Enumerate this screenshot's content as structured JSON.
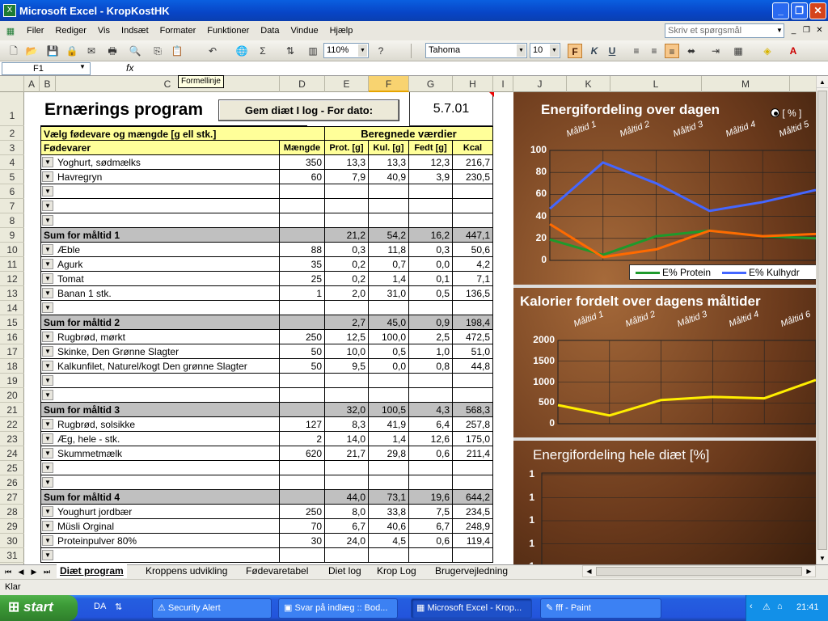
{
  "window": {
    "title": "Microsoft Excel - KropKostHK",
    "app_icon": "X",
    "controls": [
      "_",
      "❐",
      "✕"
    ]
  },
  "menu": {
    "items": [
      "Filer",
      "Rediger",
      "Vis",
      "Indsæt",
      "Formater",
      "Funktioner",
      "Data",
      "Vindue",
      "Hjælp"
    ],
    "help_placeholder": "Skriv et spørgsmål",
    "mdi": [
      "_",
      "❐",
      "✕"
    ]
  },
  "toolbar": {
    "zoom": "110%",
    "font": "Tahoma",
    "size": "10",
    "bold": "F",
    "italic": "K",
    "underline": "U"
  },
  "formula": {
    "namebox": "F1",
    "fx": "fx",
    "tooltip": "Formellinje"
  },
  "columns": [
    "A",
    "B",
    "C",
    "D",
    "E",
    "F",
    "G",
    "H",
    "I",
    "J",
    "K",
    "L",
    "M"
  ],
  "rows": [
    "1",
    "2",
    "3",
    "4",
    "5",
    "6",
    "7",
    "8",
    "9",
    "10",
    "11",
    "12",
    "13",
    "14",
    "15",
    "16",
    "17",
    "18",
    "19",
    "20",
    "21",
    "22",
    "23",
    "24",
    "25",
    "26",
    "27",
    "28",
    "29",
    "30",
    "31"
  ],
  "sheet": {
    "title": "Ernærings program",
    "save_button": "Gem diæt I log - For dato:",
    "date": "5.7.01",
    "header1_left": "Vælg fødevare og mængde [g ell stk.]",
    "header1_right": "Beregnede værdier",
    "header2": [
      "Fødevarer",
      "Mængde",
      "Prot. [g]",
      "Kul. [g]",
      "Fedt [g]",
      "Kcal"
    ],
    "data_rows": [
      {
        "food": "Yoghurt, sødmælks",
        "amt": "350",
        "p": "13,3",
        "k": "13,3",
        "f": "12,3",
        "kcal": "216,7"
      },
      {
        "food": "Havregryn",
        "amt": "60",
        "p": "7,9",
        "k": "40,9",
        "f": "3,9",
        "kcal": "230,5"
      },
      {
        "food": "",
        "amt": "",
        "p": "",
        "k": "",
        "f": "",
        "kcal": ""
      },
      {
        "food": "",
        "amt": "",
        "p": "",
        "k": "",
        "f": "",
        "kcal": ""
      },
      {
        "food": "",
        "amt": "",
        "p": "",
        "k": "",
        "f": "",
        "kcal": ""
      },
      {
        "sum": true,
        "food": "Sum for måltid 1",
        "amt": "",
        "p": "21,2",
        "k": "54,2",
        "f": "16,2",
        "kcal": "447,1"
      },
      {
        "food": "Æble",
        "amt": "88",
        "p": "0,3",
        "k": "11,8",
        "f": "0,3",
        "kcal": "50,6"
      },
      {
        "food": "Agurk",
        "amt": "35",
        "p": "0,2",
        "k": "0,7",
        "f": "0,0",
        "kcal": "4,2"
      },
      {
        "food": "Tomat",
        "amt": "25",
        "p": "0,2",
        "k": "1,4",
        "f": "0,1",
        "kcal": "7,1"
      },
      {
        "food": "Banan 1 stk.",
        "amt": "1",
        "p": "2,0",
        "k": "31,0",
        "f": "0,5",
        "kcal": "136,5"
      },
      {
        "food": "",
        "amt": "",
        "p": "",
        "k": "",
        "f": "",
        "kcal": ""
      },
      {
        "sum": true,
        "food": "Sum for måltid 2",
        "amt": "",
        "p": "2,7",
        "k": "45,0",
        "f": "0,9",
        "kcal": "198,4"
      },
      {
        "food": "Rugbrød, mørkt",
        "amt": "250",
        "p": "12,5",
        "k": "100,0",
        "f": "2,5",
        "kcal": "472,5"
      },
      {
        "food": "Skinke, Den Grønne Slagter",
        "amt": "50",
        "p": "10,0",
        "k": "0,5",
        "f": "1,0",
        "kcal": "51,0"
      },
      {
        "food": "Kalkunfilet, Naturel/kogt Den grønne Slagter",
        "amt": "50",
        "p": "9,5",
        "k": "0,0",
        "f": "0,8",
        "kcal": "44,8"
      },
      {
        "food": "",
        "amt": "",
        "p": "",
        "k": "",
        "f": "",
        "kcal": ""
      },
      {
        "food": "",
        "amt": "",
        "p": "",
        "k": "",
        "f": "",
        "kcal": ""
      },
      {
        "sum": true,
        "food": "Sum for måltid 3",
        "amt": "",
        "p": "32,0",
        "k": "100,5",
        "f": "4,3",
        "kcal": "568,3"
      },
      {
        "food": "Rugbrød, solsikke",
        "amt": "127",
        "p": "8,3",
        "k": "41,9",
        "f": "6,4",
        "kcal": "257,8"
      },
      {
        "food": "Æg, hele - stk.",
        "amt": "2",
        "p": "14,0",
        "k": "1,4",
        "f": "12,6",
        "kcal": "175,0"
      },
      {
        "food": "Skummetmælk",
        "amt": "620",
        "p": "21,7",
        "k": "29,8",
        "f": "0,6",
        "kcal": "211,4"
      },
      {
        "food": "",
        "amt": "",
        "p": "",
        "k": "",
        "f": "",
        "kcal": ""
      },
      {
        "food": "",
        "amt": "",
        "p": "",
        "k": "",
        "f": "",
        "kcal": ""
      },
      {
        "sum": true,
        "food": "Sum for måltid 4",
        "amt": "",
        "p": "44,0",
        "k": "73,1",
        "f": "19,6",
        "kcal": "644,2"
      },
      {
        "food": "Youghurt jordbær",
        "amt": "250",
        "p": "8,0",
        "k": "33,8",
        "f": "7,5",
        "kcal": "234,5"
      },
      {
        "food": "Müsli Orginal",
        "amt": "70",
        "p": "6,7",
        "k": "40,6",
        "f": "6,7",
        "kcal": "248,9"
      },
      {
        "food": "Proteinpulver 80%",
        "amt": "30",
        "p": "24,0",
        "k": "4,5",
        "f": "0,6",
        "kcal": "119,4"
      },
      {
        "food": "",
        "amt": "",
        "p": "",
        "k": "",
        "f": "",
        "kcal": ""
      }
    ]
  },
  "chart_data": [
    {
      "type": "line",
      "title": "Energifordeling over dagen",
      "categories": [
        "Måltid 1",
        "Måltid 2",
        "Måltid 3",
        "Måltid 4",
        "Måltid 5"
      ],
      "ylim": [
        0,
        100
      ],
      "yticks": [
        "100",
        "80",
        "60",
        "40",
        "20",
        "0"
      ],
      "radio_label": "[ % ]",
      "series": [
        {
          "name": "E% Protein",
          "color": "#1e9a2c",
          "values": [
            19,
            5,
            22,
            27,
            22,
            20
          ]
        },
        {
          "name": "E% Kulhydr",
          "color": "#4466ff",
          "values": [
            47,
            89,
            70,
            45,
            53,
            64
          ]
        },
        {
          "name": "",
          "color": "#ff6a00",
          "values": [
            33,
            3,
            10,
            27,
            22,
            24
          ]
        }
      ],
      "legend": [
        "E% Protein",
        "E% Kulhydr"
      ]
    },
    {
      "type": "line",
      "title": "Kalorier fordelt over dagens måltider",
      "categories": [
        "Måltid 1",
        "Måltid 2",
        "Måltid 3",
        "Måltid 4",
        "Måltid 6"
      ],
      "ylim": [
        0,
        2000
      ],
      "yticks": [
        "2000",
        "1500",
        "1000",
        "500",
        "0"
      ],
      "series": [
        {
          "color": "#ffee00",
          "values": [
            447,
            198,
            568,
            644,
            610,
            1050
          ]
        }
      ]
    },
    {
      "type": "bar",
      "title": "Energifordeling hele diæt [%]",
      "yticks": [
        "1",
        "1",
        "1",
        "1",
        "1"
      ]
    }
  ],
  "tabs": [
    "Diæt program",
    "Kroppens udvikling",
    "Fødevaretabel",
    "Diet log",
    "Krop Log",
    "Brugervejledning"
  ],
  "status": "Klar",
  "taskbar": {
    "start": "start",
    "lang": "DA",
    "tasks": [
      "Security Alert",
      "Svar på indlæg :: Bod...",
      "Microsoft Excel - Krop...",
      "fff - Paint"
    ],
    "time": "21:41"
  }
}
